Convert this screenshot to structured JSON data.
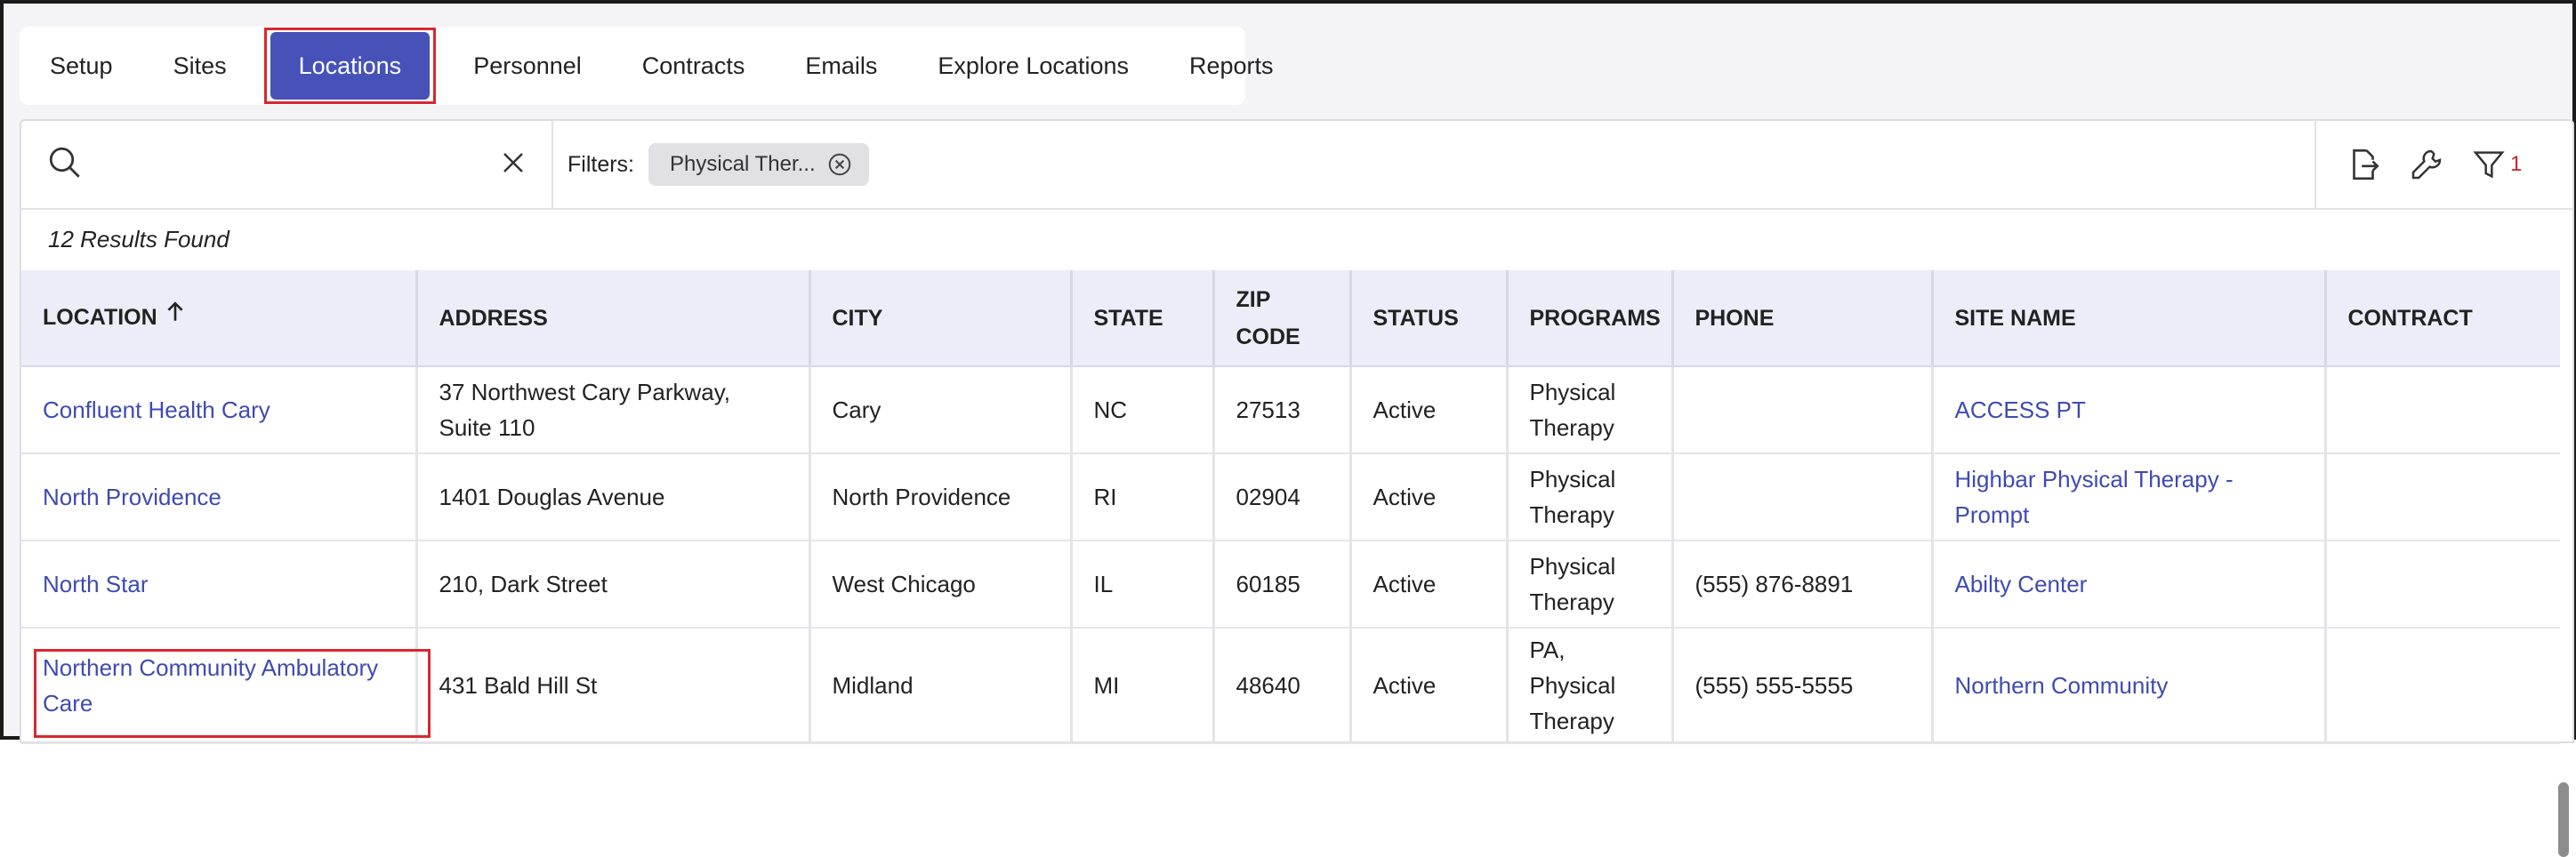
{
  "tabs": [
    "Setup",
    "Sites",
    "Locations",
    "Personnel",
    "Contracts",
    "Emails",
    "Explore Locations",
    "Reports"
  ],
  "active_tab": "Locations",
  "search": {
    "value": "",
    "placeholder": ""
  },
  "filters": {
    "label": "Filters:",
    "chip": "Physical Ther..."
  },
  "filter_count": "1",
  "results_text": "12 Results Found",
  "columns": [
    "LOCATION",
    "ADDRESS",
    "CITY",
    "STATE",
    "ZIP CODE",
    "STATUS",
    "PROGRAMS",
    "PHONE",
    "SITE NAME",
    "CONTRACT"
  ],
  "sort": {
    "column": "LOCATION",
    "direction": "ascending"
  },
  "rows": [
    {
      "location": "Confluent Health Cary",
      "address": "37 Northwest Cary Parkway, Suite 110",
      "city": "Cary",
      "state": "NC",
      "zip": "27513",
      "status": "Active",
      "programs": "Physical Therapy",
      "phone": "",
      "site_name": "ACCESS PT",
      "contract": ""
    },
    {
      "location": "North Providence",
      "address": "1401 Douglas Avenue",
      "city": "North Providence",
      "state": "RI",
      "zip": "02904",
      "status": "Active",
      "programs": "Physical Therapy",
      "phone": "",
      "site_name": "Highbar Physical Therapy - Prompt",
      "contract": ""
    },
    {
      "location": "North Star",
      "address": "210, Dark Street",
      "city": "West Chicago",
      "state": "IL",
      "zip": "60185",
      "status": "Active",
      "programs": "Physical Therapy",
      "phone": "(555) 876-8891",
      "site_name": "Abilty Center",
      "contract": ""
    },
    {
      "location": "Northern Community Ambulatory Care",
      "address": "431 Bald Hill St",
      "city": "Midland",
      "state": "MI",
      "zip": "48640",
      "status": "Active",
      "programs": "PA, Physical Therapy",
      "phone": "(555) 555-5555",
      "site_name": "Northern Community",
      "contract": ""
    }
  ],
  "colors": {
    "accent": "#4652b8",
    "link": "#3e4bb0",
    "highlight": "#d7282f",
    "header_bg": "#ededfa"
  }
}
